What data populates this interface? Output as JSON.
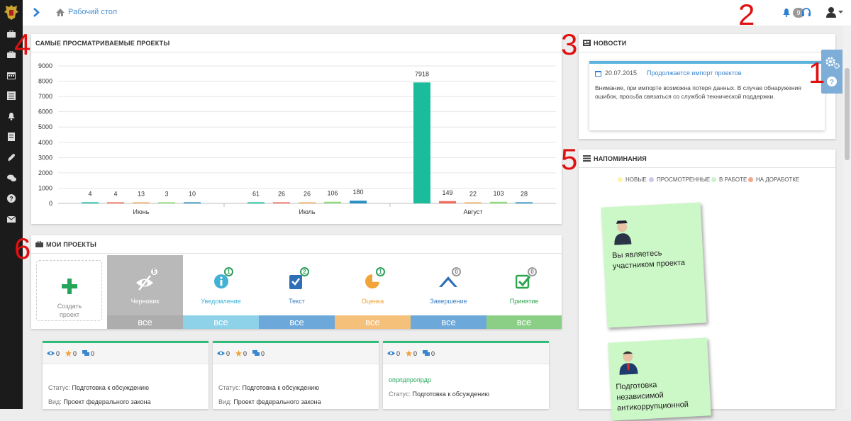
{
  "breadcrumb": {
    "label": "Рабочий стол"
  },
  "notifications": {
    "count": "9"
  },
  "chart_panel": {
    "title": "САМЫЕ ПРОСМАТРИВАЕМЫЕ ПРОЕКТЫ"
  },
  "chart_data": {
    "type": "bar",
    "categories": [
      "Июнь",
      "Июль",
      "Август"
    ],
    "series": [
      {
        "color": "#1abc9c",
        "values": [
          4,
          61,
          7918
        ]
      },
      {
        "color": "#f26c5a",
        "values": [
          4,
          26,
          149
        ]
      },
      {
        "color": "#f6b26b",
        "values": [
          13,
          26,
          22
        ]
      },
      {
        "color": "#8fdc7c",
        "values": [
          3,
          106,
          103
        ]
      },
      {
        "color": "#2a8fc4",
        "values": [
          10,
          180,
          28
        ]
      }
    ],
    "ylim": [
      0,
      9000
    ],
    "yticks": [
      0,
      1000,
      2000,
      3000,
      4000,
      5000,
      6000,
      7000,
      8000,
      9000
    ],
    "grid": true
  },
  "news_panel": {
    "title": "НОВОСТИ",
    "date": "20.07.2015",
    "headline": "Продолжается импорт проектов",
    "body": "Внимание, при импорте возможна потеря данных. В случае обнаружения ошибок, просьба связаться со службой технической поддержки."
  },
  "reminders_panel": {
    "title": "НАПОМИНАНИЯ",
    "legend": [
      {
        "label": "НОВЫЕ",
        "color": "#fbf5a8"
      },
      {
        "label": "ПРОСМОТРЕННЫЕ",
        "color": "#c9c9ef"
      },
      {
        "label": "В РАБОТЕ",
        "color": "#ccf3c8"
      },
      {
        "label": "НА ДОРАБОТКЕ",
        "color": "#f2a68a"
      }
    ],
    "notes": [
      {
        "text": "Вы являетесь участником проекта"
      },
      {
        "text": "Подготовка независимой антикоррупционной"
      }
    ]
  },
  "projects_panel": {
    "title": "МОИ ПРОЕКТЫ",
    "create_label": "Создать проект",
    "tiles": [
      {
        "label": "Черновик",
        "count": "5",
        "all": "все",
        "color": "#b9b9b9"
      },
      {
        "label": "Уведомление",
        "count": "1",
        "all": "все",
        "color": "#8dd2e8"
      },
      {
        "label": "Текст",
        "count": "2",
        "all": "все",
        "color": "#6ca8d9"
      },
      {
        "label": "Оценка",
        "count": "1",
        "all": "все",
        "color": "#f5c07a"
      },
      {
        "label": "Завершение",
        "count": "0",
        "all": "все",
        "color": "#6ca8d9"
      },
      {
        "label": "Принятие",
        "count": "0",
        "all": "все",
        "color": "#8bcf87"
      }
    ]
  },
  "project_cards": [
    {
      "views": "0",
      "stars": "0",
      "comments": "0",
      "name": "",
      "status_key": "Статус:",
      "status": "Подготовка к обсуждению",
      "type_key": "Вид:",
      "type": "Проект федерального закона"
    },
    {
      "views": "0",
      "stars": "0",
      "comments": "0",
      "name": "",
      "status_key": "Статус:",
      "status": "Подготовка к обсуждению",
      "type_key": "Вид:",
      "type": "Проект федерального закона"
    },
    {
      "views": "0",
      "stars": "0",
      "comments": "0",
      "name": "опрпдпропрдр",
      "status_key": "Статус:",
      "status": "Подготовка к обсуждению",
      "type_key": "",
      "type": ""
    }
  ],
  "annotations": [
    "1",
    "2",
    "3",
    "4",
    "5",
    "6"
  ]
}
